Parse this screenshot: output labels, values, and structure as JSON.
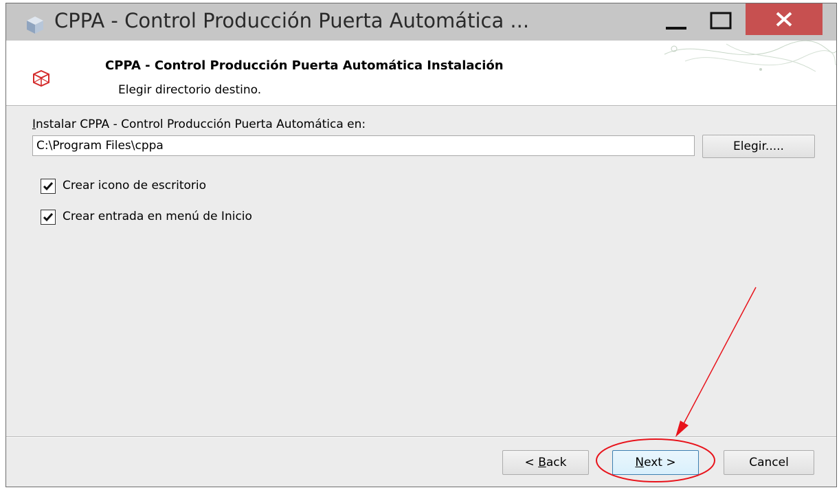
{
  "window": {
    "title": "CPPA - Control Producción Puerta Automática ...",
    "controls": [
      "minimize-icon",
      "maximize-icon",
      "close-icon"
    ],
    "close_color": "#c75050"
  },
  "header": {
    "title": "CPPA - Control Producción Puerta Automática Instalación",
    "subtitle": "Elegir directorio destino.",
    "icon": "cube-icon"
  },
  "install": {
    "label_mnemonic": "I",
    "label_rest": "nstalar CPPA - Control Producción Puerta Automática en:",
    "path_value": "C:\\Program Files\\cppa",
    "browse_label": "Elegir....."
  },
  "options": [
    {
      "label": "Crear icono de escritorio",
      "checked": true
    },
    {
      "label": "Crear entrada en menú de Inicio",
      "checked": true
    }
  ],
  "footer": {
    "back_prefix": "< ",
    "back_mnemonic": "B",
    "back_rest": "ack",
    "next_mnemonic": "N",
    "next_rest": "ext >",
    "cancel_label": "Cancel"
  },
  "annotation": {
    "color": "#e8131b"
  }
}
